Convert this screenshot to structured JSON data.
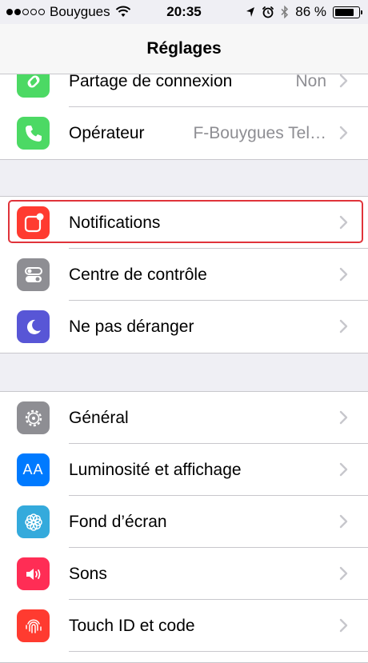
{
  "status_bar": {
    "carrier": "Bouygues",
    "time": "20:35",
    "battery_percent": "86 %",
    "battery_level": 0.86,
    "signal_bars_filled": 2
  },
  "nav": {
    "title": "Réglages"
  },
  "groups": [
    {
      "rows": [
        {
          "label": "Partage de connexion",
          "value": "Non",
          "icon": "hotspot-icon",
          "color": "#4cd964"
        },
        {
          "label": "Opérateur",
          "value": "F-Bouygues Tel…",
          "icon": "phone-icon",
          "color": "#4cd964"
        }
      ]
    },
    {
      "rows": [
        {
          "label": "Notifications",
          "icon": "notifications-icon",
          "color": "#ff3b30"
        },
        {
          "label": "Centre de contrôle",
          "icon": "control-center-icon",
          "color": "#8e8e93"
        },
        {
          "label": "Ne pas déranger",
          "icon": "moon-icon",
          "color": "#5856d6"
        }
      ]
    },
    {
      "rows": [
        {
          "label": "Général",
          "icon": "gear-icon",
          "color": "#8e8e93"
        },
        {
          "label": "Luminosité et affichage",
          "icon": "display-icon",
          "color": "#007aff"
        },
        {
          "label": "Fond d’écran",
          "icon": "wallpaper-icon",
          "color": "#34aadc"
        },
        {
          "label": "Sons",
          "icon": "speaker-icon",
          "color": "#ff2d55"
        },
        {
          "label": "Touch ID et code",
          "icon": "fingerprint-icon",
          "color": "#ff3b30"
        }
      ]
    }
  ],
  "icon_glyphs": {
    "display": "AA"
  }
}
